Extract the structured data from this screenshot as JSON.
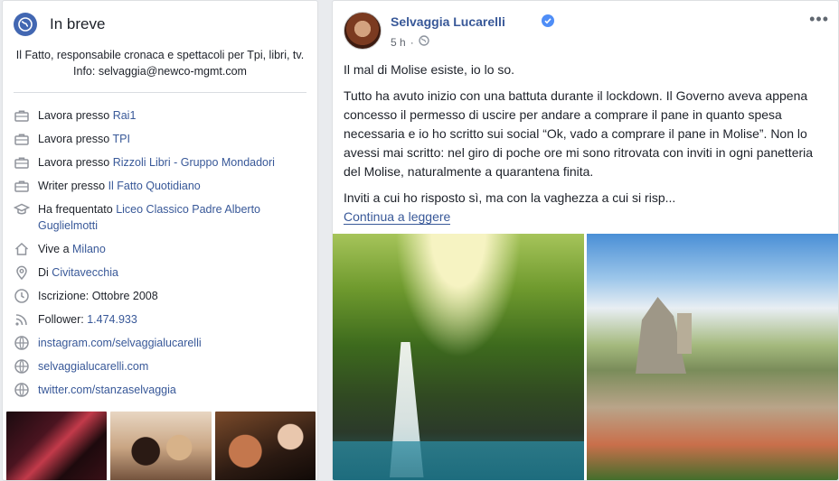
{
  "intro": {
    "title": "In breve",
    "bio": "Il Fatto, responsabile cronaca e spettacoli per Tpi, libri, tv. Info: selvaggia@newco-mgmt.com",
    "facts": [
      {
        "icon": "briefcase-icon",
        "prefix": "Lavora presso",
        "link": "Rai1"
      },
      {
        "icon": "briefcase-icon",
        "prefix": "Lavora presso",
        "link": "TPI"
      },
      {
        "icon": "briefcase-icon",
        "prefix": "Lavora presso",
        "link": "Rizzoli Libri - Gruppo Mondadori"
      },
      {
        "icon": "briefcase-icon",
        "prefix": "Writer presso",
        "link": "Il Fatto Quotidiano"
      },
      {
        "icon": "graduation-cap-icon",
        "prefix": "Ha frequentato",
        "link": "Liceo Classico Padre Alberto Guglielmotti"
      },
      {
        "icon": "home-icon",
        "prefix": "Vive a",
        "link": "Milano"
      },
      {
        "icon": "location-pin-icon",
        "prefix": "Di",
        "link": "Civitavecchia"
      },
      {
        "icon": "clock-icon",
        "prefix": "Iscrizione: Ottobre 2008",
        "link": ""
      },
      {
        "icon": "rss-icon",
        "prefix": "Follower:",
        "link": "1.474.933"
      },
      {
        "icon": "globe-icon",
        "prefix": "",
        "link": "instagram.com/selvaggialucarelli"
      },
      {
        "icon": "globe-icon",
        "prefix": "",
        "link": "selvaggialucarelli.com"
      },
      {
        "icon": "globe-icon",
        "prefix": "",
        "link": "twitter.com/stanzaselvaggia"
      }
    ]
  },
  "post": {
    "author": "Selvaggia Lucarelli",
    "time": "5 h",
    "paragraphs": [
      "Il mal di Molise esiste, io lo so.",
      "Tutto ha avuto inizio con una battuta durante il lockdown. Il Governo aveva appena concesso il permesso di uscire per andare a comprare il pane in quanto spesa necessaria e io ho scritto sui social “Ok, vado a comprare il pane in Molise”. Non lo avessi mai scritto: nel giro di poche ore mi sono ritrovata con inviti in ogni panetteria del Molise, naturalmente a quarantena finita.",
      "Inviti a cui ho risposto sì, ma con la vaghezza a cui si risp..."
    ],
    "continue_label": "Continua a leggere",
    "more_label": "•••"
  },
  "colors": {
    "link": "#385898",
    "accent": "#4267b2",
    "verified": "#4f8ef7"
  }
}
